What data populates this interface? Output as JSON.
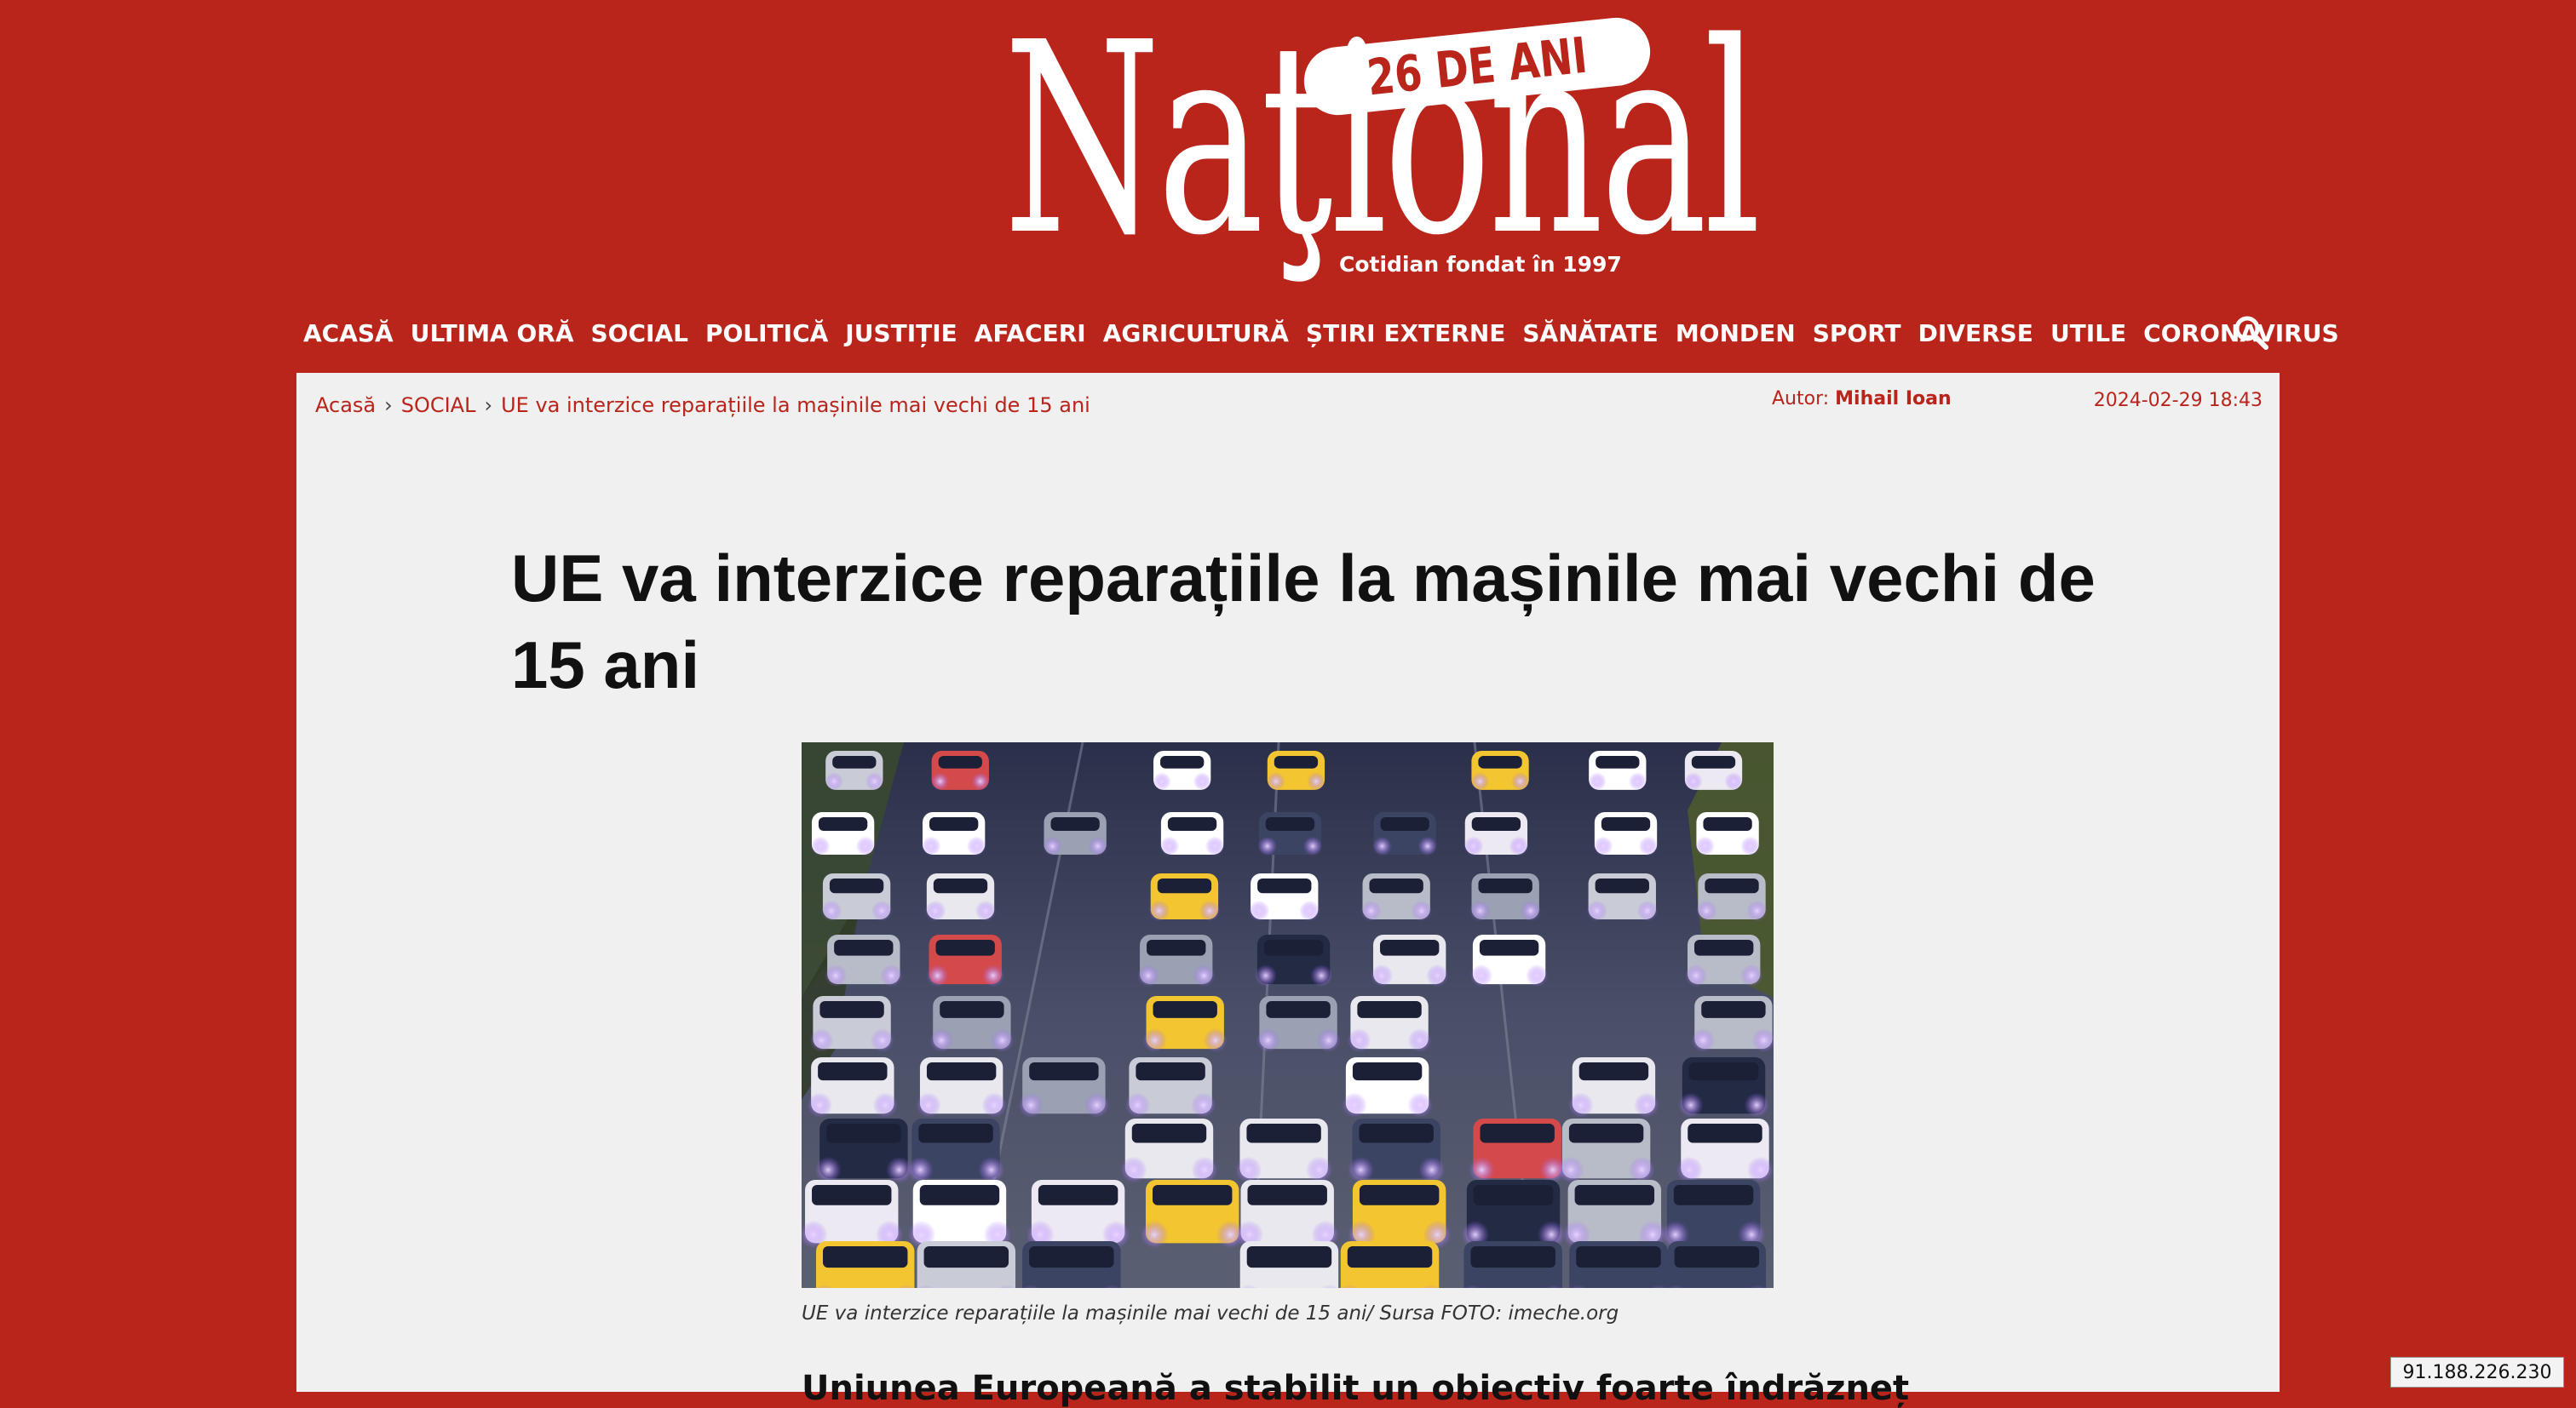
{
  "brand": {
    "logo_text": "Naţional",
    "anniversary_badge": "26 DE ANI",
    "tagline": "Cotidian fondat în 1997"
  },
  "nav": {
    "items": [
      {
        "label": "ACASĂ"
      },
      {
        "label": "ULTIMA ORĂ"
      },
      {
        "label": "SOCIAL"
      },
      {
        "label": "POLITICĂ"
      },
      {
        "label": "JUSTIȚIE"
      },
      {
        "label": "AFACERI"
      },
      {
        "label": "AGRICULTURĂ"
      },
      {
        "label": "ȘTIRI EXTERNE"
      },
      {
        "label": "SĂNĂTATE"
      },
      {
        "label": "MONDEN"
      },
      {
        "label": "SPORT"
      },
      {
        "label": "DIVERSE"
      },
      {
        "label": "UTILE"
      },
      {
        "label": "CORONAVIRUS"
      }
    ],
    "search_icon": "search-icon"
  },
  "breadcrumb": {
    "home": "Acasă",
    "category": "SOCIAL",
    "current": "UE va interzice reparațiile la mașinile mai vechi de 15 ani"
  },
  "meta": {
    "author_label": "Autor:",
    "author_name": "Mihail Ioan",
    "datetime": "2024-02-29 18:43"
  },
  "article": {
    "title": "UE va interzice reparațiile la mașinile mai vechi de 15 ani",
    "image_caption": "UE va interzice reparațiile la mașinile mai vechi de 15 ani/ Sursa FOTO: imeche.org",
    "lead_partial": "Uniunea Europeană a stabilit un obiectiv foarte îndrăzneț"
  },
  "overlay": {
    "ip_address": "91.188.226.230"
  },
  "colors": {
    "brand_red": "#b9241b",
    "panel_bg": "#f0f0f0",
    "title_text": "#111111"
  }
}
